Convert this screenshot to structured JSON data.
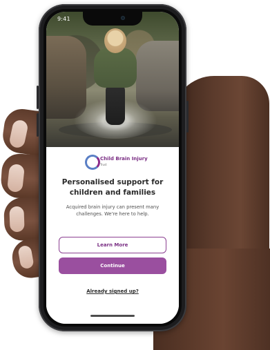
{
  "status_bar": {
    "time": "9:41"
  },
  "app": {
    "brand_name": "Child Brain Injury",
    "brand_subtitle": "Trust",
    "headline": "Personalised support for children and families",
    "description": "Acquired brain injury can present many challenges. We're here to help.",
    "learn_more_label": "Learn More",
    "continue_label": "Continue",
    "signed_up_link": "Already signed up?"
  },
  "colors": {
    "brand_purple": "#9a4f9f",
    "brand_purple_dark": "#7a2f84",
    "brand_blue": "#5a7fc5",
    "text_dark": "#2a2a2a",
    "text_muted": "#4f4f4f",
    "phone_frame": "#1d1d1f"
  },
  "icons": {
    "logo_mark": "brain-injury-trust-logo-icon",
    "camera": "front-camera-icon"
  }
}
